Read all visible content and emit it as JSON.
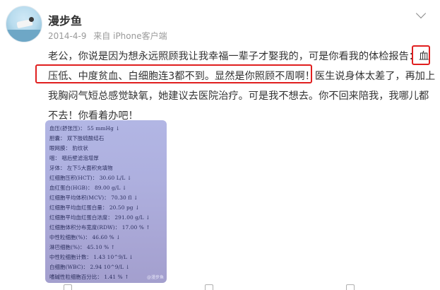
{
  "user": {
    "name": "漫步鱼"
  },
  "meta": {
    "date": "2014-4-9",
    "source": "来自 iPhone客户端"
  },
  "post": {
    "line1_a": "老公，你说是因为想永远照顾我让我幸福一辈子才娶我的，可是你看我的体检报告：",
    "line1_b": "血",
    "line2_a": "压低、中度贫血、白细胞连3都不到。显然是你照顾不周啊！",
    "line2_b": "医生说身体太差了，再加上",
    "line3": "我胸闷气短总感觉缺氧，她建议去医院治疗。可是我不想去。你不回来陪我，我哪儿都",
    "line4": "不去！你看着办吧！"
  },
  "report": {
    "rows": [
      "血压(舒张压)： 55 mmHg ↓",
      "胆囊：  双下肢硫酸结石",
      "眼网膜：  豹纹状",
      "咽：  咽后壁滤泡增厚",
      "牙体：  左下5大面积充填物",
      "红细胞压积(HCT)：  30.60 L/L ↓",
      "血红蛋白(HGB)：  89.00 g/L ↓",
      "红细胞平均体积(MCV)：  70.30 fl ↓",
      "红细胞平均血红蛋白量：  20.50 pg ↓",
      "红细胞平均血红蛋白浓度：  291.00 g/L ↓",
      "红细胞体积分布宽度(RDW)：  17.00 % ↑",
      "中性粒细胞(%)：  46.60 % ↓",
      "淋巴细胞(%)：  45.10 % ↑",
      "中性粒细胞计数：  1.43 10^9/L ↓",
      "白细胞(WBC)：  2.94 10^9/L ↓",
      "嗜碱性粒细胞百分比：  1.41 % ↑"
    ],
    "watermark": "@漫步鱼"
  }
}
